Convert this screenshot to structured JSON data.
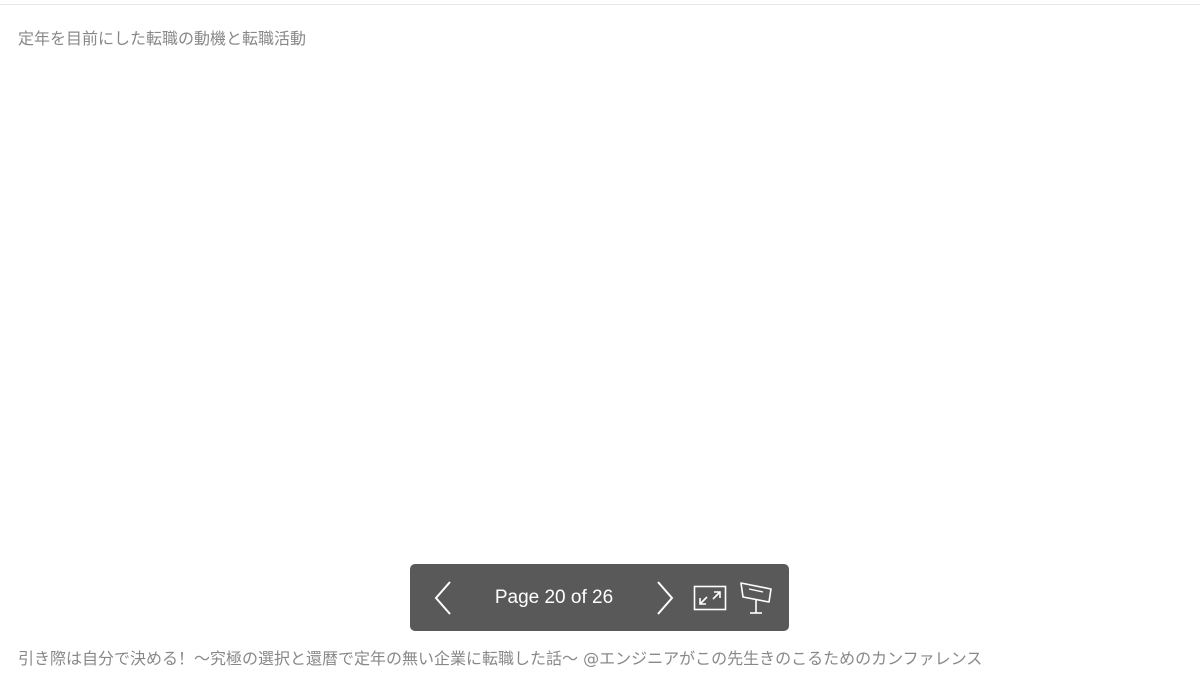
{
  "slide": {
    "title": "定年を目前にした転職の動機と転職活動"
  },
  "toolbar": {
    "prev_icon": "chevron-left-icon",
    "page_indicator": "Page 20 of 26",
    "next_icon": "chevron-right-icon",
    "expand_icon": "expand-icon",
    "present_icon": "presentation-icon",
    "background_color": "#595959"
  },
  "footer": {
    "caption": "引き際は自分で決める！～究極の選択と還暦で定年の無い企業に転職した話～ @エンジニアがこの先生きのこるためのカンファレンス"
  }
}
